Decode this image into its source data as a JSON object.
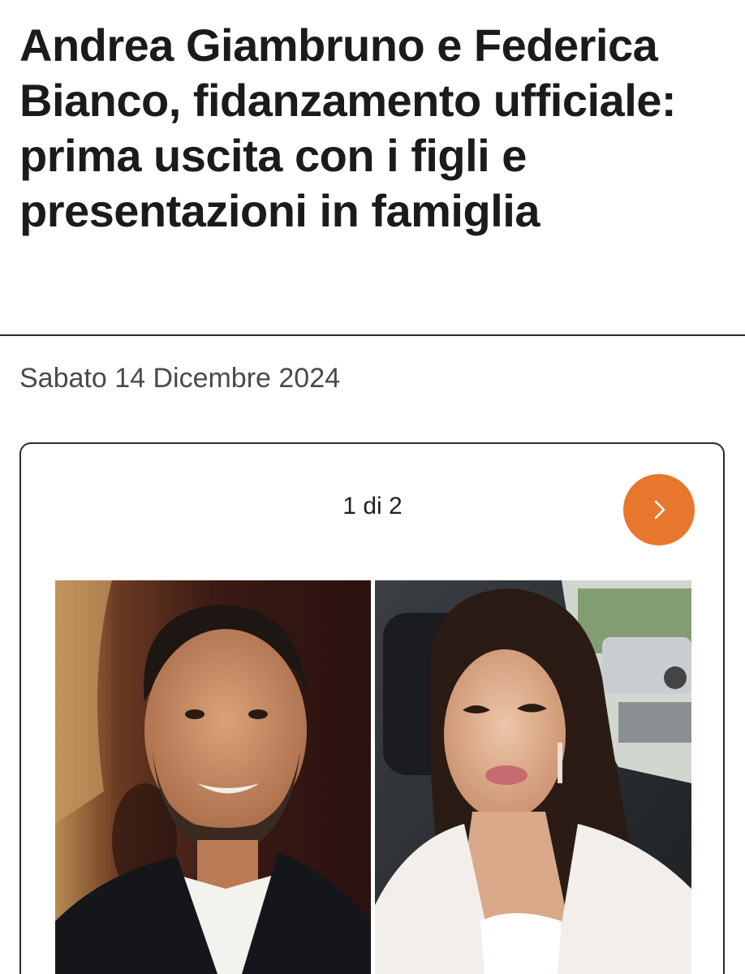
{
  "article": {
    "headline": "Andrea Giambruno e Federica Bianco, fidanzamento ufficiale: prima uscita con i figli e presentazioni in famiglia",
    "date": "Sabato 14 Dicembre 2024"
  },
  "gallery": {
    "counter": "1 di 2",
    "next_icon": "chevron-right-icon",
    "accent_color": "#e8772e",
    "photos": [
      {
        "subject": "man-portrait"
      },
      {
        "subject": "woman-selfie-in-car"
      }
    ]
  }
}
